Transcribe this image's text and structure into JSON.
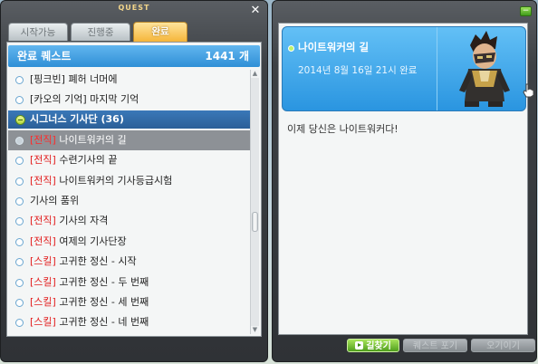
{
  "left_window": {
    "title": "QUEST",
    "tabs": [
      {
        "label": "시작가능",
        "active": false
      },
      {
        "label": "진행중",
        "active": false
      },
      {
        "label": "완료",
        "active": true
      }
    ],
    "list_header": {
      "label": "완료 퀘스트",
      "count": "1441 개"
    },
    "rows": [
      {
        "prefix": "",
        "text": "[핑크빈] 폐허 너머에",
        "type": "quest"
      },
      {
        "prefix": "",
        "text": "[카오의 기억] 마지막 기억",
        "type": "quest"
      },
      {
        "prefix": "",
        "text": "시그너스 기사단 (36)",
        "type": "category"
      },
      {
        "prefix": "[전직]",
        "text": " 나이트워커의 길",
        "type": "selected"
      },
      {
        "prefix": "[전직]",
        "text": " 수련기사의 끝",
        "type": "quest"
      },
      {
        "prefix": "[전직]",
        "text": " 나이트워커의 기사등급시험",
        "type": "quest"
      },
      {
        "prefix": "",
        "text": "기사의 품위",
        "type": "quest"
      },
      {
        "prefix": "[전직]",
        "text": " 기사의 자격",
        "type": "quest"
      },
      {
        "prefix": "[전직]",
        "text": " 여제의 기사단장",
        "type": "quest"
      },
      {
        "prefix": "[스킬]",
        "text": " 고귀한 정신 - 시작",
        "type": "quest"
      },
      {
        "prefix": "[스킬]",
        "text": " 고귀한 정신 - 두 번째",
        "type": "quest"
      },
      {
        "prefix": "[스킬]",
        "text": " 고귀한 정신 - 세 번째",
        "type": "quest"
      },
      {
        "prefix": "[스킬]",
        "text": " 고귀한 정신 - 네 번째",
        "type": "quest"
      }
    ]
  },
  "right_window": {
    "quest_name": "나이트워커의 길",
    "completed_at": "2014년 8월 16일 21시 완료",
    "description": "이제 당신은 나이트워커다!",
    "buttons": {
      "find_path": "길찾기",
      "give_up": "퀘스트 포기",
      "share": "오기이기"
    }
  },
  "colors": {
    "accent_blue": "#2f8fd6",
    "tab_active": "#f5b53a",
    "tag_red": "#e21c1c",
    "go_green": "#4f9e1d"
  }
}
